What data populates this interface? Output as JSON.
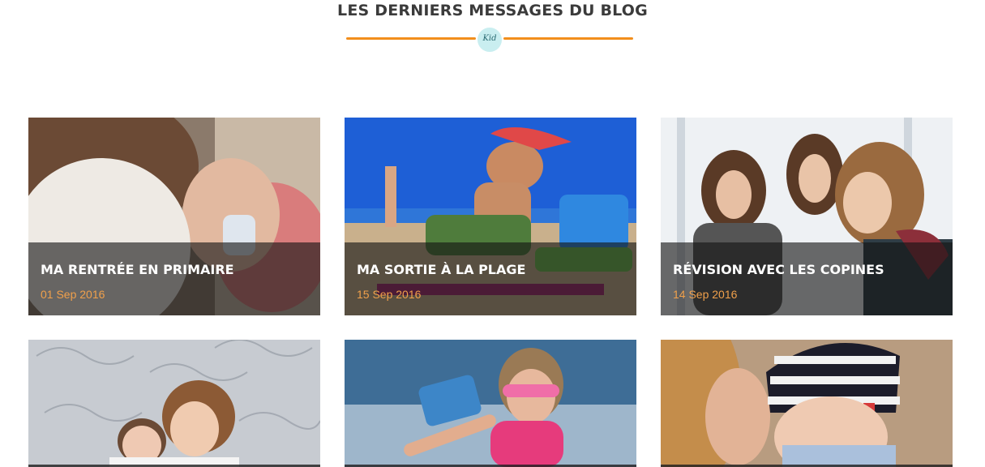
{
  "section": {
    "title": "LES DERNIERS MESSAGES DU BLOG",
    "logo_text": "Kid"
  },
  "posts": [
    {
      "title": "MA RENTRÉE EN PRIMAIRE",
      "date": "01 Sep 2016"
    },
    {
      "title": "MA SORTIE À LA PLAGE",
      "date": "15 Sep 2016"
    },
    {
      "title": "RÉVISION AVEC LES COPINES",
      "date": "14 Sep 2016"
    }
  ],
  "colors": {
    "accent": "#f28e1c",
    "date": "#f0a04b",
    "title": "#3b3b3b"
  }
}
